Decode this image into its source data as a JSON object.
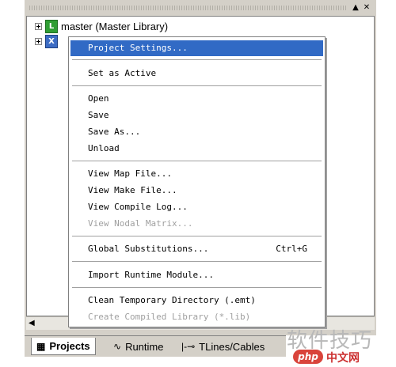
{
  "panel": {
    "tb_pin": "▲",
    "tb_close": "✕"
  },
  "tree": {
    "items": [
      {
        "icon": "L",
        "label": "master (Master Library)"
      },
      {
        "icon": "X",
        "label": ""
      }
    ]
  },
  "context_menu": {
    "groups": [
      [
        {
          "label": "Project Settings...",
          "highlighted": true
        }
      ],
      [
        {
          "label": "Set as Active"
        }
      ],
      [
        {
          "label": "Open"
        },
        {
          "label": "Save"
        },
        {
          "label": "Save As..."
        },
        {
          "label": "Unload"
        }
      ],
      [
        {
          "label": "View Map File..."
        },
        {
          "label": "View Make File..."
        },
        {
          "label": "View Compile Log..."
        },
        {
          "label": "View Nodal Matrix...",
          "disabled": true
        }
      ],
      [
        {
          "label": "Global Substitutions...",
          "shortcut": "Ctrl+G"
        }
      ],
      [
        {
          "label": "Import Runtime Module..."
        }
      ],
      [
        {
          "label": "Clean Temporary Directory (.emt)"
        },
        {
          "label": "Create Compiled Library (*.lib)",
          "disabled": true
        }
      ]
    ]
  },
  "tabs": [
    {
      "label": "Projects",
      "icon": "projects-icon",
      "active": true
    },
    {
      "label": "Runtime",
      "icon": "runtime-icon"
    },
    {
      "label": "TLines/Cables",
      "icon": "tlines-icon"
    }
  ],
  "watermark": {
    "cn": "软件技巧",
    "badge": "php",
    "site": "中文网"
  }
}
